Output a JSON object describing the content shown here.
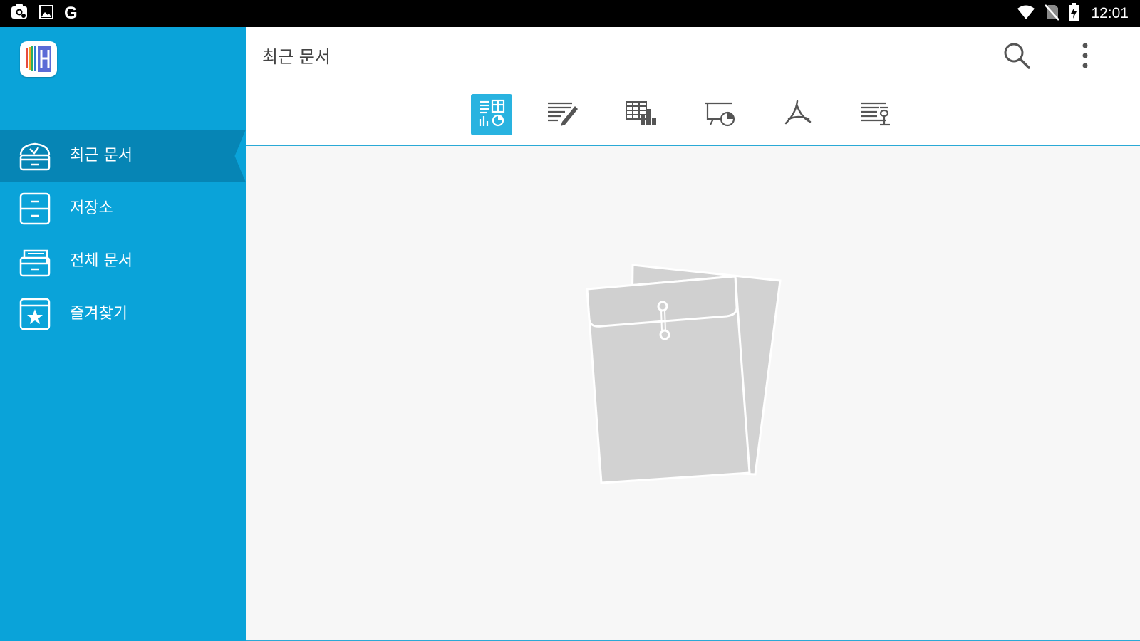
{
  "status_bar": {
    "time": "12:01",
    "left_icons": [
      "screenshot-icon",
      "image-icon",
      "google-g-icon"
    ],
    "google_letter": "G",
    "right_icons": [
      "wifi-icon",
      "no-sim-icon",
      "battery-charging-icon"
    ]
  },
  "sidebar": {
    "logo": "app-logo-icon",
    "items": [
      {
        "label": "최근 문서",
        "icon": "recent-documents-icon",
        "active": true
      },
      {
        "label": "저장소",
        "icon": "storage-icon",
        "active": false
      },
      {
        "label": "전체 문서",
        "icon": "all-documents-icon",
        "active": false
      },
      {
        "label": "즐겨찾기",
        "icon": "favorites-star-icon",
        "active": false
      }
    ]
  },
  "header": {
    "title": "최근 문서",
    "actions": [
      "search-icon",
      "more-vert-icon"
    ]
  },
  "filters": {
    "selected_index": 0,
    "tabs": [
      "all-formats-icon",
      "word-document-icon",
      "spreadsheet-icon",
      "presentation-icon",
      "pdf-icon",
      "hwp-document-icon"
    ]
  },
  "empty_state": {
    "illustration": "empty-envelope-folder-icon"
  },
  "colors": {
    "sidebar_bg": "#0aa3d9",
    "sidebar_active": "#0685b5",
    "accent": "#29b3e0",
    "content_bg": "#f7f7f7"
  }
}
